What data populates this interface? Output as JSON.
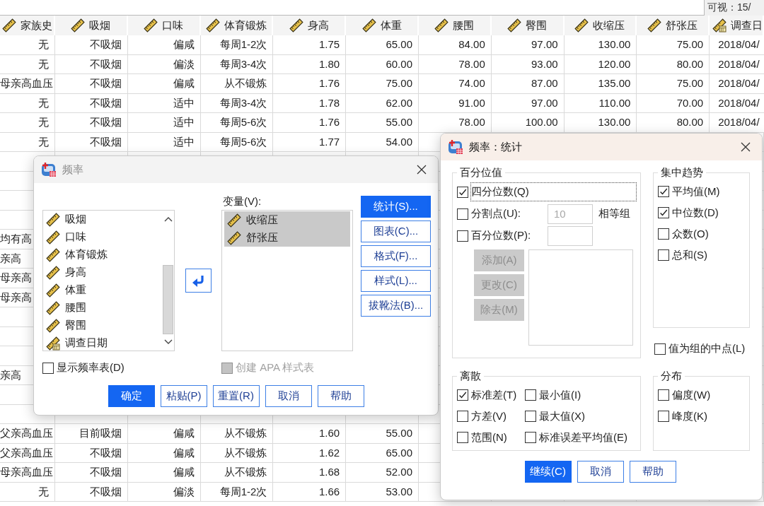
{
  "toolbar": {
    "visible_count": "可视：15/"
  },
  "grid": {
    "columns": [
      {
        "label": "家族史",
        "kind": "scale"
      },
      {
        "label": "吸烟",
        "kind": "scale"
      },
      {
        "label": "口味",
        "kind": "scale"
      },
      {
        "label": "体育锻炼",
        "kind": "scale"
      },
      {
        "label": "身高",
        "kind": "scale"
      },
      {
        "label": "体重",
        "kind": "scale"
      },
      {
        "label": "腰围",
        "kind": "scale"
      },
      {
        "label": "臀围",
        "kind": "scale"
      },
      {
        "label": "收缩压",
        "kind": "scale"
      },
      {
        "label": "舒张压",
        "kind": "scale"
      },
      {
        "label": "调查日",
        "kind": "date"
      }
    ],
    "rows": [
      {
        "kind": "full",
        "cells": [
          "无",
          "不吸烟",
          "偏咸",
          "每周1-2次",
          "1.75",
          "65.00",
          "84.00",
          "97.00",
          "130.00",
          "75.00",
          "2018/04/"
        ]
      },
      {
        "kind": "full",
        "cells": [
          "无",
          "不吸烟",
          "偏淡",
          "每周3-4次",
          "1.80",
          "60.00",
          "78.00",
          "93.00",
          "120.00",
          "80.00",
          "2018/04/"
        ]
      },
      {
        "kind": "full",
        "cells": [
          "母亲高血压",
          "不吸烟",
          "偏咸",
          "从不锻炼",
          "1.76",
          "75.00",
          "74.00",
          "87.00",
          "135.00",
          "75.00",
          "2018/04/"
        ]
      },
      {
        "kind": "full",
        "cells": [
          "无",
          "不吸烟",
          "适中",
          "每周3-4次",
          "1.78",
          "62.00",
          "91.00",
          "97.00",
          "110.00",
          "70.00",
          "2018/04/"
        ]
      },
      {
        "kind": "full",
        "cells": [
          "无",
          "不吸烟",
          "适中",
          "每周5-6次",
          "1.76",
          "55.00",
          "78.00",
          "100.00",
          "130.00",
          "80.00",
          "2018/04/"
        ]
      },
      {
        "kind": "full",
        "cells": [
          "无",
          "不吸烟",
          "适中",
          "每周5-6次",
          "1.77",
          "54.00"
        ]
      },
      {
        "kind": "blank"
      },
      {
        "kind": "blank"
      },
      {
        "kind": "blank"
      },
      {
        "kind": "blank"
      },
      {
        "kind": "fragment",
        "cells": [
          "均有高"
        ]
      },
      {
        "kind": "fragment",
        "cells": [
          "亲高"
        ]
      },
      {
        "kind": "fragment",
        "cells": [
          "母亲高"
        ]
      },
      {
        "kind": "fragment",
        "cells": [
          "母亲高"
        ]
      },
      {
        "kind": "blank"
      },
      {
        "kind": "blank"
      },
      {
        "kind": "blank"
      },
      {
        "kind": "fragment",
        "cells": [
          "亲高"
        ]
      },
      {
        "kind": "blank"
      },
      {
        "kind": "blank"
      },
      {
        "kind": "full",
        "cells": [
          "父亲高血压",
          "目前吸烟",
          "偏咸",
          "从不锻炼",
          "1.60",
          "55.00"
        ]
      },
      {
        "kind": "full",
        "cells": [
          "父亲高血压",
          "不吸烟",
          "偏咸",
          "从不锻炼",
          "1.62",
          "65.00"
        ]
      },
      {
        "kind": "full",
        "cells": [
          "母亲高血压",
          "不吸烟",
          "偏咸",
          "从不锻炼",
          "1.68",
          "52.00"
        ]
      },
      {
        "kind": "full",
        "cells": [
          "无",
          "不吸烟",
          "偏淡",
          "每周1-2次",
          "1.66",
          "53.00"
        ]
      }
    ]
  },
  "frequencies_dialog": {
    "title": "频率",
    "active": false,
    "source_list": {
      "items": [
        {
          "label": "吸烟",
          "kind": "scale",
          "selected": false
        },
        {
          "label": "口味",
          "kind": "scale",
          "selected": false
        },
        {
          "label": "体育锻炼",
          "kind": "scale",
          "selected": false
        },
        {
          "label": "身高",
          "kind": "scale",
          "selected": false
        },
        {
          "label": "体重",
          "kind": "scale",
          "selected": false
        },
        {
          "label": "腰围",
          "kind": "scale",
          "selected": false
        },
        {
          "label": "臀围",
          "kind": "scale",
          "selected": false
        },
        {
          "label": "调查日期",
          "kind": "date",
          "selected": false
        }
      ]
    },
    "target_list": {
      "label": "变量(V):",
      "items": [
        {
          "label": "收缩压",
          "kind": "scale",
          "selected": true
        },
        {
          "label": "舒张压",
          "kind": "scale",
          "selected": true
        }
      ]
    },
    "side_buttons": [
      {
        "label": "统计(S)...",
        "primary": true
      },
      {
        "label": "图表(C)...",
        "primary": false
      },
      {
        "label": "格式(F)...",
        "primary": false
      },
      {
        "label": "样式(L)...",
        "primary": false
      },
      {
        "label": "拔靴法(B)...",
        "primary": false
      }
    ],
    "checkboxes": [
      {
        "label": "显示频率表(D)",
        "checked": false,
        "disabled": false
      },
      {
        "label": "创建 APA 样式表",
        "checked": false,
        "disabled": true
      }
    ],
    "buttons": [
      {
        "label": "确定",
        "primary": true
      },
      {
        "label": "粘贴(P)",
        "primary": false
      },
      {
        "label": "重置(R)",
        "primary": false
      },
      {
        "label": "取消",
        "primary": false
      },
      {
        "label": "帮助",
        "primary": false
      }
    ]
  },
  "statistics_dialog": {
    "title": "频率：统计",
    "active": true,
    "percentile_group": {
      "title": "百分位值",
      "options": [
        {
          "kind": "check",
          "label": "四分位数(Q)",
          "checked": true,
          "focused": true
        },
        {
          "kind": "check_input",
          "label": "分割点(U):",
          "checked": false,
          "value": "10",
          "suffix": "相等组",
          "input_disabled": true
        },
        {
          "kind": "check_input",
          "label": "百分位数(P):",
          "checked": false
        }
      ],
      "buttons": [
        {
          "label": "添加(A)",
          "disabled": true
        },
        {
          "label": "更改(C)",
          "disabled": true
        },
        {
          "label": "除去(M)",
          "disabled": true
        }
      ]
    },
    "central_group": {
      "title": "集中趋势",
      "options": [
        {
          "label": "平均值(M)",
          "checked": true
        },
        {
          "label": "中位数(D)",
          "checked": true
        },
        {
          "label": "众数(O)",
          "checked": false
        },
        {
          "label": "总和(S)",
          "checked": false
        }
      ]
    },
    "midpoint_option": {
      "label": "值为组的中点(L)",
      "checked": false
    },
    "dispersion_group": {
      "title": "离散",
      "options": [
        {
          "label": "标准差(T)",
          "checked": true
        },
        {
          "label": "最小值(I)",
          "checked": false
        },
        {
          "label": "方差(V)",
          "checked": false
        },
        {
          "label": "最大值(X)",
          "checked": false
        },
        {
          "label": "范围(N)",
          "checked": false
        },
        {
          "label": "标准误差平均值(E)",
          "checked": false
        }
      ]
    },
    "distribution_group": {
      "title": "分布",
      "options": [
        {
          "label": "偏度(W)",
          "checked": false
        },
        {
          "label": "峰度(K)",
          "checked": false
        }
      ]
    },
    "buttons": [
      {
        "label": "继续(C)",
        "primary": true
      },
      {
        "label": "取消",
        "primary": false
      },
      {
        "label": "帮助",
        "primary": false
      }
    ]
  }
}
